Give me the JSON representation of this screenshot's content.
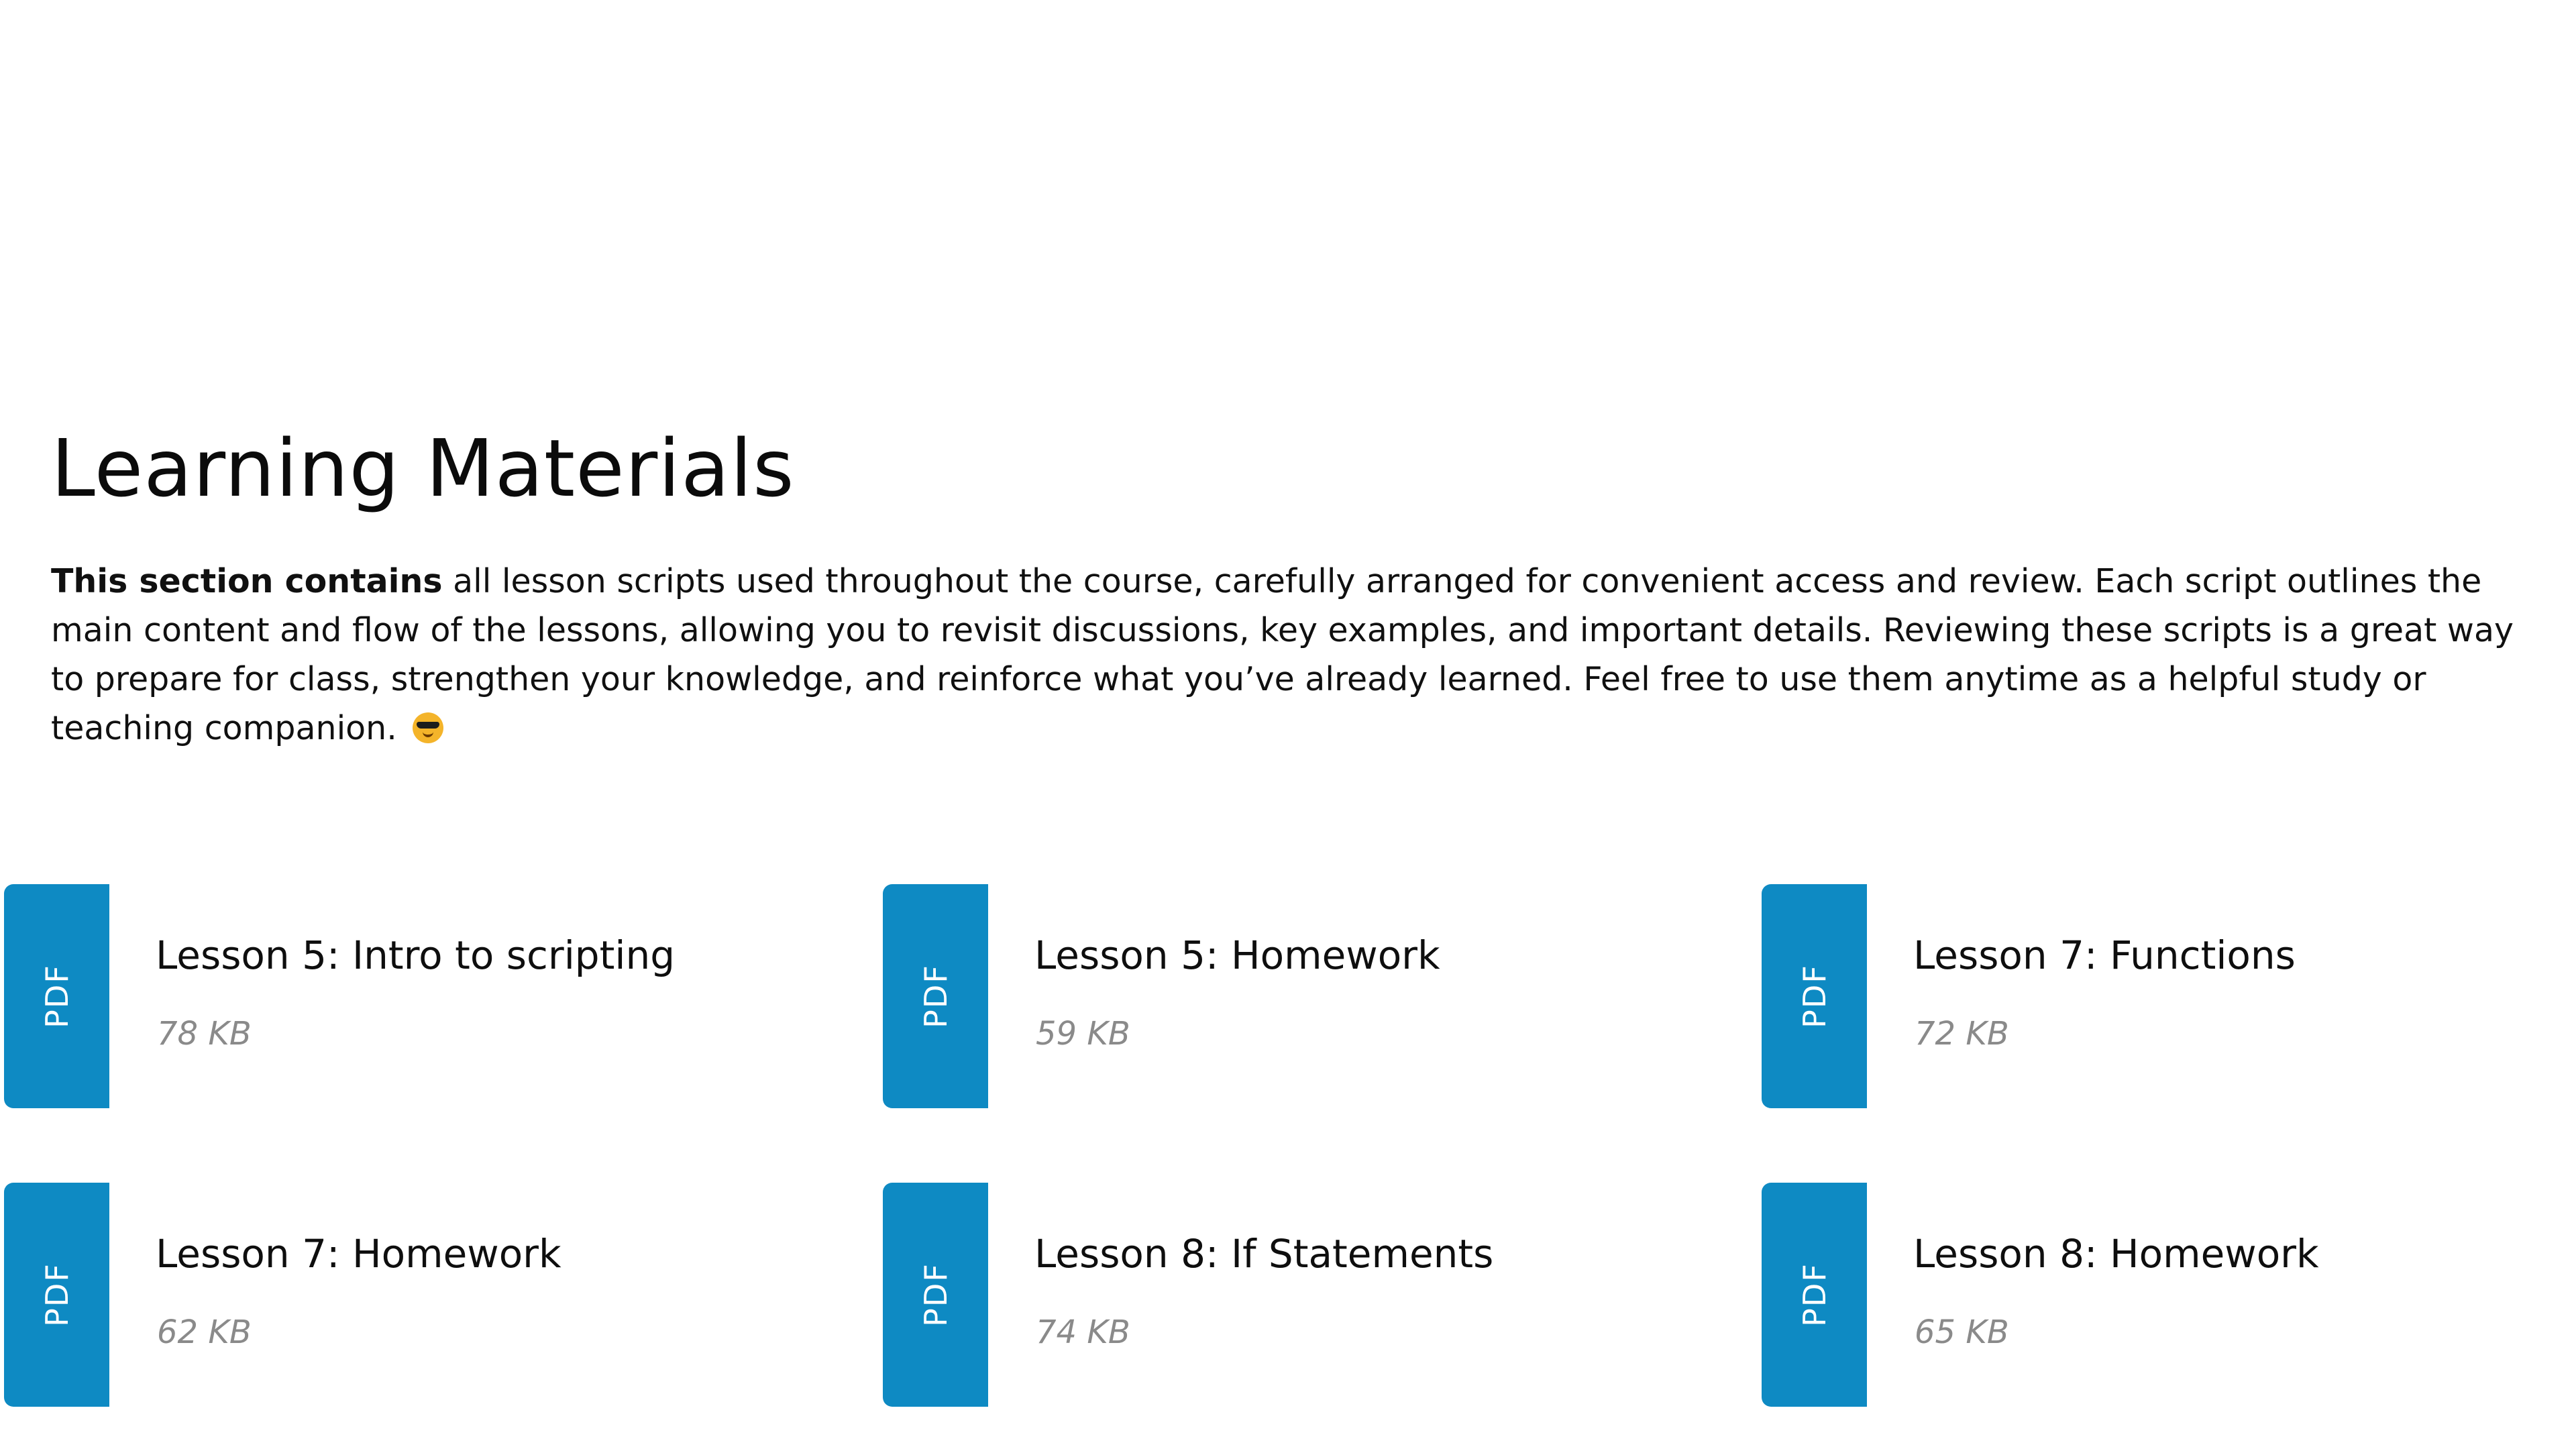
{
  "section": {
    "title": "Learning Materials",
    "intro_bold": "This section contains",
    "intro_text": " all lesson scripts used throughout the course, carefully arranged for convenient access and review. Each script outlines the main content and flow of the lessons, allowing you to revisit discussions, key examples, and important details. Reviewing these scripts is a great way to prepare for class, strengthen your knowledge, and reinforce what you’ve already learned. Feel free to use them anytime as a helpful study or teaching companion.",
    "intro_emoji": "smiling-face-with-sunglasses-icon"
  },
  "files": [
    {
      "type": "PDF",
      "name": "Lesson 5: Intro to scripting",
      "size": "78 KB"
    },
    {
      "type": "PDF",
      "name": "Lesson 5: Homework",
      "size": "59 KB"
    },
    {
      "type": "PDF",
      "name": "Lesson 7: Functions",
      "size": "72 KB"
    },
    {
      "type": "PDF",
      "name": "Lesson 7: Homework",
      "size": "62 KB"
    },
    {
      "type": "PDF",
      "name": "Lesson 8: If Statements",
      "size": "74 KB"
    },
    {
      "type": "PDF",
      "name": "Lesson 8: Homework",
      "size": "65 KB"
    }
  ],
  "colors": {
    "pdf_tab": "#0e8ac3",
    "size_text": "#8a8a8a"
  }
}
